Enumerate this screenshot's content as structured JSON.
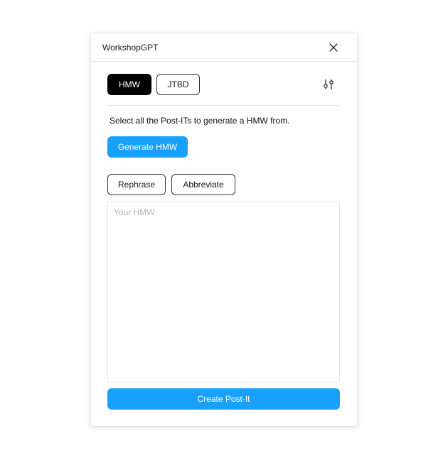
{
  "window": {
    "title": "WorkshopGPT",
    "close_icon": "close-icon"
  },
  "tabs": [
    {
      "label": "HMW",
      "active": true
    },
    {
      "label": "JTBD",
      "active": false
    }
  ],
  "settings_icon": "sliders-icon",
  "instruction": "Select all the Post-ITs to generate a HMW from.",
  "actions": {
    "generate_label": "Generate HMW",
    "rephrase_label": "Rephrase",
    "abbreviate_label": "Abbreviate",
    "create_label": "Create Post-It"
  },
  "hmw_input": {
    "placeholder": "Your HMW",
    "value": ""
  },
  "colors": {
    "accent": "#18a0fb",
    "active_tab": "#000000"
  }
}
